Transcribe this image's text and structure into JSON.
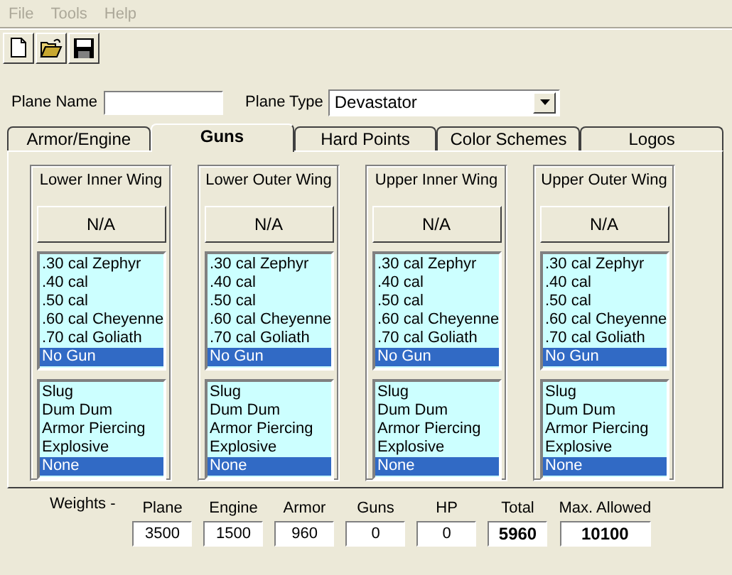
{
  "menu": [
    {
      "label": "File",
      "disabled": true
    },
    {
      "label": "Tools",
      "disabled": true
    },
    {
      "label": "Help",
      "disabled": true
    }
  ],
  "toolbar": [
    {
      "kind": "new"
    },
    {
      "kind": "open"
    },
    {
      "kind": "save"
    }
  ],
  "plane_name": {
    "label": "Plane Name"
  },
  "plane_type": {
    "label": "Plane Type",
    "value": "Devastator"
  },
  "tabs": [
    {
      "label": "Armor/Engine",
      "selected": false
    },
    {
      "label": "Guns",
      "selected": true
    },
    {
      "label": "Hard Points",
      "selected": false
    },
    {
      "label": "Color Schemes",
      "selected": false
    },
    {
      "label": "Logos",
      "selected": false
    }
  ],
  "wings": [
    {
      "title": "Lower Inner Wing",
      "button": "N/A",
      "guns": [
        {
          "label": ".30 cal Zephyr",
          "selected": false
        },
        {
          "label": ".40 cal",
          "selected": false
        },
        {
          "label": ".50 cal",
          "selected": false
        },
        {
          "label": ".60 cal Cheyenne",
          "selected": false
        },
        {
          "label": ".70 cal Goliath",
          "selected": false
        },
        {
          "label": "No Gun",
          "selected": true
        }
      ],
      "ammo": [
        {
          "label": "Slug",
          "selected": false
        },
        {
          "label": "Dum Dum",
          "selected": false
        },
        {
          "label": "Armor Piercing",
          "selected": false
        },
        {
          "label": "Explosive",
          "selected": false
        },
        {
          "label": "None",
          "selected": true
        }
      ]
    },
    {
      "title": "Lower Outer Wing",
      "button": "N/A",
      "guns": [
        {
          "label": ".30 cal Zephyr",
          "selected": false
        },
        {
          "label": ".40 cal",
          "selected": false
        },
        {
          "label": ".50 cal",
          "selected": false
        },
        {
          "label": ".60 cal Cheyenne",
          "selected": false
        },
        {
          "label": ".70 cal Goliath",
          "selected": false
        },
        {
          "label": "No Gun",
          "selected": true
        }
      ],
      "ammo": [
        {
          "label": "Slug",
          "selected": false
        },
        {
          "label": "Dum Dum",
          "selected": false
        },
        {
          "label": "Armor Piercing",
          "selected": false
        },
        {
          "label": "Explosive",
          "selected": false
        },
        {
          "label": "None",
          "selected": true
        }
      ]
    },
    {
      "title": "Upper Inner Wing",
      "button": "N/A",
      "guns": [
        {
          "label": ".30 cal Zephyr",
          "selected": false
        },
        {
          "label": ".40 cal",
          "selected": false
        },
        {
          "label": ".50 cal",
          "selected": false
        },
        {
          "label": ".60 cal Cheyenne",
          "selected": false
        },
        {
          "label": ".70 cal Goliath",
          "selected": false
        },
        {
          "label": "No Gun",
          "selected": true
        }
      ],
      "ammo": [
        {
          "label": "Slug",
          "selected": false
        },
        {
          "label": "Dum Dum",
          "selected": false
        },
        {
          "label": "Armor Piercing",
          "selected": false
        },
        {
          "label": "Explosive",
          "selected": false
        },
        {
          "label": "None",
          "selected": true
        }
      ]
    },
    {
      "title": "Upper Outer Wing",
      "button": "N/A",
      "guns": [
        {
          "label": ".30 cal Zephyr",
          "selected": false
        },
        {
          "label": ".40 cal",
          "selected": false
        },
        {
          "label": ".50 cal",
          "selected": false
        },
        {
          "label": ".60 cal Cheyenne",
          "selected": false
        },
        {
          "label": ".70 cal Goliath",
          "selected": false
        },
        {
          "label": "No Gun",
          "selected": true
        }
      ],
      "ammo": [
        {
          "label": "Slug",
          "selected": false
        },
        {
          "label": "Dum Dum",
          "selected": false
        },
        {
          "label": "Armor Piercing",
          "selected": false
        },
        {
          "label": "Explosive",
          "selected": false
        },
        {
          "label": "None",
          "selected": true
        }
      ]
    }
  ],
  "weights": {
    "label": "Weights -",
    "items": [
      {
        "label": "Plane",
        "value": "3500",
        "emphasized": false
      },
      {
        "label": "Engine",
        "value": "1500",
        "emphasized": false
      },
      {
        "label": "Armor",
        "value": "960",
        "emphasized": false
      },
      {
        "label": "Guns",
        "value": "0",
        "emphasized": false
      },
      {
        "label": "HP",
        "value": "0",
        "emphasized": false
      },
      {
        "label": "Total",
        "value": "5960",
        "emphasized": true
      },
      {
        "label": "Max. Allowed",
        "value": "10100",
        "emphasized": true
      }
    ]
  }
}
